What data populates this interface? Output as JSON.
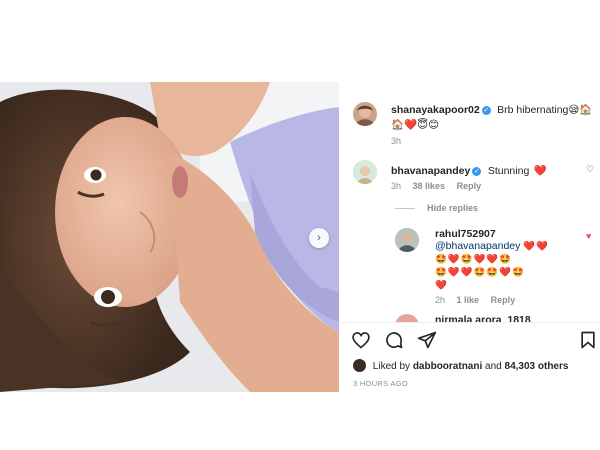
{
  "post": {
    "caption": {
      "username": "shanayakapoor02",
      "text": "Brb hibernating",
      "emojis": "😪🏠🏠❤️😇😊",
      "time": "3h"
    },
    "comments": [
      {
        "username": "bhavanapandey",
        "text": "Stunning",
        "emoji": "❤️",
        "time": "3h",
        "likes": "38 likes",
        "reply": "Reply",
        "hide_replies": "Hide replies"
      }
    ],
    "replies": [
      {
        "username": "rahul752907",
        "mention": "@bhavanapandey",
        "emojis_1": "❤️❤️",
        "emojis_2": "🤩❤️🤩❤️❤️🤩",
        "emojis_3": "🤩❤️❤️🤩🤩❤️🤩",
        "emojis_4": "❤️",
        "time": "2h",
        "likes": "1 like",
        "reply": "Reply"
      },
      {
        "username": "nirmala arora_1818"
      }
    ],
    "liked_by": {
      "prefix": "Liked by",
      "user": "dabbooratnani",
      "middle": "and",
      "count": "84,303 others"
    },
    "timestamp": "3 HOURS AGO",
    "icons": {
      "like": "heart-outline-icon",
      "comment": "comment-icon",
      "share": "send-icon",
      "save": "bookmark-icon"
    },
    "colors": {
      "verified": "#3897f0",
      "liked_heart": "#ed4956"
    }
  }
}
